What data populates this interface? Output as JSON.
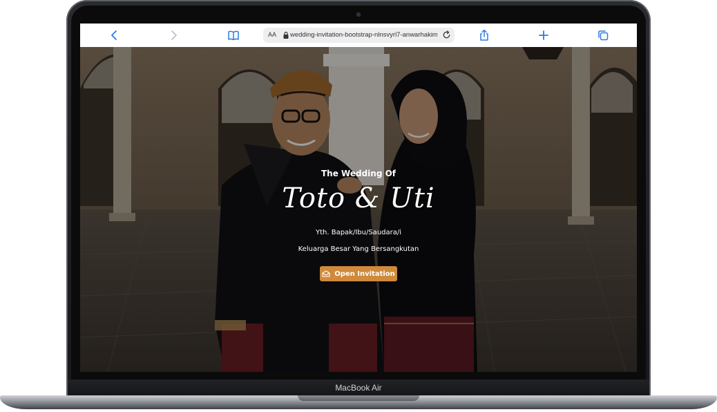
{
  "browser": {
    "url": "wedding-invitation-bootstrap-nlnsvyrl7-anwarhakim",
    "reader_label": "AA",
    "icons": [
      "back-icon",
      "forward-icon",
      "bookmarks-icon",
      "lock-icon",
      "reload-icon",
      "share-icon",
      "new-tab-icon",
      "tabs-icon"
    ]
  },
  "hero": {
    "pretitle": "The Wedding Of",
    "couple": "Toto & Uti",
    "guest_line1": "Yth. Bapak/Ibu/Saudara/i",
    "guest_line2": "Keluarga Besar Yang Bersangkutan",
    "button_label": "Open Invitation",
    "button_color": "#cf8a3c"
  },
  "device": {
    "label": "MacBook Air"
  }
}
